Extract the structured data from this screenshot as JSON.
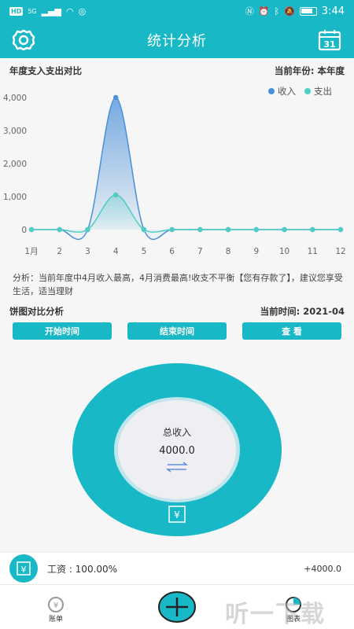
{
  "status": {
    "time": "3:44",
    "left_badge": "HD",
    "network": "5G"
  },
  "header": {
    "title": "统计分析",
    "calendar_day": "31"
  },
  "annual": {
    "title": "年度支入支出对比",
    "year_label": "当前年份: 本年度"
  },
  "chart_data": {
    "type": "line",
    "categories": [
      "1月",
      "2",
      "3",
      "4",
      "5",
      "6",
      "7",
      "8",
      "9",
      "10",
      "11",
      "12"
    ],
    "series": [
      {
        "name": "收入",
        "values": [
          0,
          0,
          0,
          4000,
          0,
          0,
          0,
          0,
          0,
          0,
          0,
          0
        ],
        "color": "#4a90d9"
      },
      {
        "name": "支出",
        "values": [
          0,
          0,
          0,
          1050,
          0,
          0,
          0,
          0,
          0,
          0,
          0,
          0
        ],
        "color": "#4ecdc4"
      }
    ],
    "yticks": [
      "0",
      "1,000",
      "2,000",
      "3,000",
      "4,000"
    ],
    "ylim": [
      0,
      4000
    ],
    "legend_position": "top-right"
  },
  "analysis": {
    "text": "分析：当前年度中4月收入最高，4月消费最高!收支不平衡【您有存款了】，建议您享受生活，适当理财"
  },
  "pie_section": {
    "title": "饼图对比分析",
    "time_label": "当前时间: 2021-04",
    "buttons": {
      "start": "开始时间",
      "end": "结束时间",
      "view": "查 看"
    },
    "center_label": "总收入",
    "center_value": "4000.0",
    "slices": [
      {
        "name": "工资",
        "value": 4000.0,
        "color": "#19b8c6"
      }
    ]
  },
  "income_list": [
    {
      "label": "工资 : 100.00%",
      "amount": "+4000.0"
    }
  ],
  "nav": {
    "ledger": "账单",
    "chart": "图表",
    "watermark": "听一下载"
  }
}
